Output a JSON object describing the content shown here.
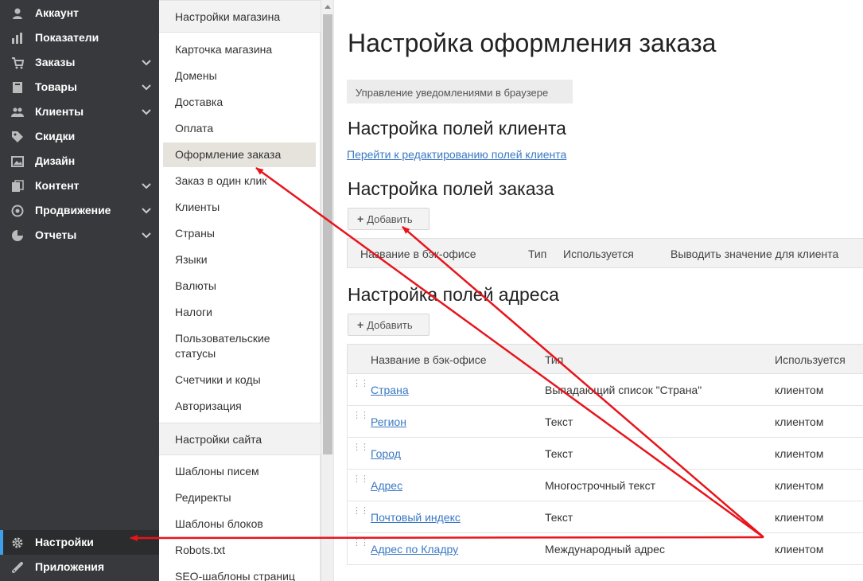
{
  "sidebar": {
    "items": [
      {
        "label": "Аккаунт",
        "icon": "user-icon",
        "has_chevron": false
      },
      {
        "label": "Показатели",
        "icon": "bar-chart-icon",
        "has_chevron": false
      },
      {
        "label": "Заказы",
        "icon": "cart-icon",
        "has_chevron": true
      },
      {
        "label": "Товары",
        "icon": "book-icon",
        "has_chevron": true
      },
      {
        "label": "Клиенты",
        "icon": "users-icon",
        "has_chevron": true
      },
      {
        "label": "Скидки",
        "icon": "tag-icon",
        "has_chevron": false
      },
      {
        "label": "Дизайн",
        "icon": "image-icon",
        "has_chevron": false
      },
      {
        "label": "Контент",
        "icon": "content-icon",
        "has_chevron": true
      },
      {
        "label": "Продвижение",
        "icon": "target-icon",
        "has_chevron": true
      },
      {
        "label": "Отчеты",
        "icon": "pie-chart-icon",
        "has_chevron": true
      }
    ],
    "bottom_items": [
      {
        "label": "Настройки",
        "icon": "gear-icon",
        "active": true
      },
      {
        "label": "Приложения",
        "icon": "puzzle-icon",
        "active": false
      }
    ]
  },
  "submenu": {
    "store_header": "Настройки магазина",
    "store_items": [
      "Карточка магазина",
      "Домены",
      "Доставка",
      "Оплата",
      "Оформление заказа",
      "Заказ в один клик",
      "Клиенты",
      "Страны",
      "Языки",
      "Валюты",
      "Налоги",
      "Пользовательские статусы",
      "Счетчики и коды",
      "Авторизация"
    ],
    "active_item": "Оформление заказа",
    "site_header": "Настройки сайта",
    "site_items": [
      "Шаблоны писем",
      "Редиректы",
      "Шаблоны блоков",
      "Robots.txt",
      "SEO-шаблоны страниц"
    ]
  },
  "main": {
    "title": "Настройка оформления заказа",
    "notify_button": "Управление уведомлениями в браузере",
    "client_fields": {
      "heading": "Настройка полей клиента",
      "link": "Перейти к редактированию полей клиента"
    },
    "order_fields": {
      "heading": "Настройка полей заказа",
      "add_button": "Добавить",
      "columns": [
        "Название в бэк-офисе",
        "Тип",
        "Используется",
        "Выводить значение для клиента"
      ]
    },
    "address_fields": {
      "heading": "Настройка полей адреса",
      "add_button": "Добавить",
      "columns": [
        "Название в бэк-офисе",
        "Тип",
        "Используется"
      ],
      "rows": [
        {
          "name": "Страна",
          "type": "Выпадающий список \"Страна\"",
          "used": "клиентом"
        },
        {
          "name": "Регион",
          "type": "Текст",
          "used": "клиентом"
        },
        {
          "name": "Город",
          "type": "Текст",
          "used": "клиентом"
        },
        {
          "name": "Адрес",
          "type": "Многострочный текст",
          "used": "клиентом"
        },
        {
          "name": "Почтовый индекс",
          "type": "Текст",
          "used": "клиентом"
        },
        {
          "name": "Адрес по Кладру",
          "type": "Международный адрес",
          "used": "клиентом"
        }
      ]
    }
  },
  "colors": {
    "sidebar_bg": "#37393c",
    "accent_active": "#3f9fe8",
    "submenu_marker": "#c3274b",
    "link": "#3a78c4",
    "annotation_arrow": "#e8141b"
  }
}
